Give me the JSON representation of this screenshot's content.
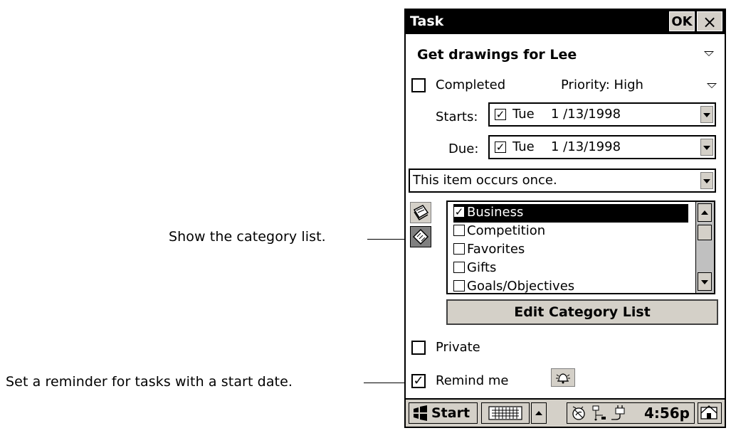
{
  "callouts": {
    "category": "Show the category list.",
    "reminder": "Set a reminder for tasks with a start date."
  },
  "window": {
    "title": "Task",
    "ok_label": "OK",
    "close_label": "×"
  },
  "task": {
    "subject": "Get drawings for Lee",
    "completed_label": "Completed",
    "completed": false,
    "priority_label": "Priority: High",
    "starts": {
      "label": "Starts:",
      "enabled": true,
      "day": "Tue",
      "date": "1 /13/1998"
    },
    "due": {
      "label": "Due:",
      "enabled": true,
      "day": "Tue",
      "date": "1 /13/1998"
    },
    "recurrence": "This item occurs once."
  },
  "categories": {
    "items": [
      {
        "label": "Business",
        "checked": true,
        "selected": true
      },
      {
        "label": "Competition",
        "checked": false,
        "selected": false
      },
      {
        "label": "Favorites",
        "checked": false,
        "selected": false
      },
      {
        "label": "Gifts",
        "checked": false,
        "selected": false
      },
      {
        "label": "Goals/Objectives",
        "checked": false,
        "selected": false
      }
    ],
    "edit_label": "Edit Category List"
  },
  "options": {
    "private_label": "Private",
    "private": false,
    "remind_label": "Remind me",
    "remind": true
  },
  "taskbar": {
    "start_label": "Start",
    "clock": "4:56p"
  },
  "icons": {
    "start": "windows-logo-icon",
    "keyboard": "keyboard-icon",
    "up": "up-arrow-icon",
    "tray_connection": "connection-icon",
    "tray_network": "network-icon",
    "tray_power": "power-plug-icon",
    "desktop": "desktop-icon",
    "reminder_sound": "alarm-bell-icon"
  }
}
